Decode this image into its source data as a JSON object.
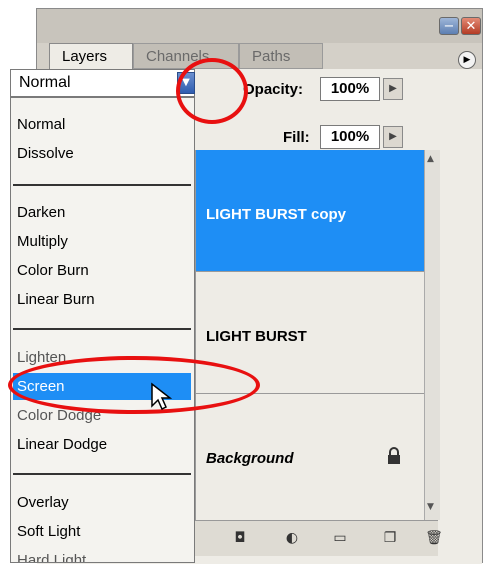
{
  "panel": {
    "tabs": [
      "Layers",
      "Channels",
      "Paths"
    ],
    "blend_mode": "Normal",
    "opacity_label": "Opacity:",
    "opacity_value": "100%",
    "fill_label": "Fill:",
    "fill_value": "100%"
  },
  "blend_menu": {
    "items": [
      "Normal",
      "Dissolve",
      "Darken",
      "Multiply",
      "Color Burn",
      "Linear Burn",
      "Lighten",
      "Screen",
      "Color Dodge",
      "Linear Dodge",
      "Overlay",
      "Soft Light",
      "Hard Light"
    ],
    "selected": "Screen"
  },
  "layers": [
    {
      "name": "LIGHT BURST copy",
      "selected": true
    },
    {
      "name": "LIGHT BURST",
      "selected": false
    },
    {
      "name": "Background",
      "selected": false,
      "locked": true
    }
  ],
  "icons": {
    "window": [
      "minimize-icon",
      "close-icon"
    ],
    "panel_menu": "panel-menu-icon",
    "dropdown": "chevron-down-icon",
    "bottom": [
      "add-mask-icon",
      "adjustment-layer-icon",
      "new-group-icon",
      "new-layer-icon",
      "trash-icon"
    ]
  },
  "colors": {
    "selection": "#1e8ef5",
    "highlight_ring": "#e81010"
  }
}
